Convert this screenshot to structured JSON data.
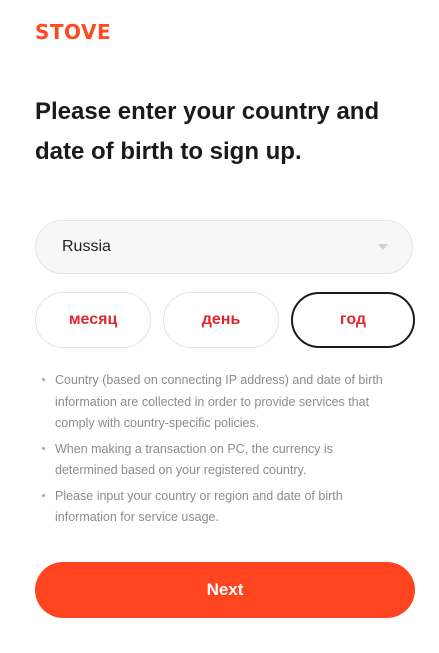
{
  "brand": {
    "logo_text": "STOVE",
    "accent_color": "#ff4520"
  },
  "heading": "Please enter your country and date of birth to sign up.",
  "country": {
    "selected": "Russia",
    "dropdown_icon": "chevron-down-icon"
  },
  "dob": {
    "month_placeholder": "месяц",
    "day_placeholder": "день",
    "year_placeholder": "год",
    "placeholder_color": "#e0282e"
  },
  "notes": [
    "Country (based on connecting IP address) and date of birth information are collected in order to provide services that comply with country-specific policies.",
    "When making a transaction on PC, the currency is determined based on your registered country.",
    "Please input your country or region and date of birth information for service usage."
  ],
  "next_button": {
    "label": "Next"
  }
}
